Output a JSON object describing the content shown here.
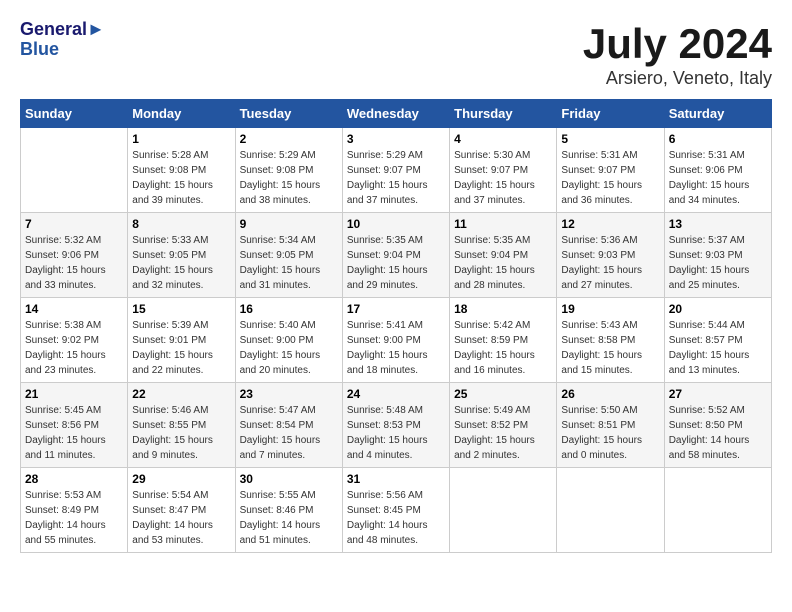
{
  "logo": {
    "line1": "General",
    "line2": "Blue"
  },
  "title": "July 2024",
  "subtitle": "Arsiero, Veneto, Italy",
  "days_of_week": [
    "Sunday",
    "Monday",
    "Tuesday",
    "Wednesday",
    "Thursday",
    "Friday",
    "Saturday"
  ],
  "weeks": [
    [
      {
        "day": "",
        "sunrise": "",
        "sunset": "",
        "daylight": ""
      },
      {
        "day": "1",
        "sunrise": "Sunrise: 5:28 AM",
        "sunset": "Sunset: 9:08 PM",
        "daylight": "Daylight: 15 hours and 39 minutes."
      },
      {
        "day": "2",
        "sunrise": "Sunrise: 5:29 AM",
        "sunset": "Sunset: 9:08 PM",
        "daylight": "Daylight: 15 hours and 38 minutes."
      },
      {
        "day": "3",
        "sunrise": "Sunrise: 5:29 AM",
        "sunset": "Sunset: 9:07 PM",
        "daylight": "Daylight: 15 hours and 37 minutes."
      },
      {
        "day": "4",
        "sunrise": "Sunrise: 5:30 AM",
        "sunset": "Sunset: 9:07 PM",
        "daylight": "Daylight: 15 hours and 37 minutes."
      },
      {
        "day": "5",
        "sunrise": "Sunrise: 5:31 AM",
        "sunset": "Sunset: 9:07 PM",
        "daylight": "Daylight: 15 hours and 36 minutes."
      },
      {
        "day": "6",
        "sunrise": "Sunrise: 5:31 AM",
        "sunset": "Sunset: 9:06 PM",
        "daylight": "Daylight: 15 hours and 34 minutes."
      }
    ],
    [
      {
        "day": "7",
        "sunrise": "Sunrise: 5:32 AM",
        "sunset": "Sunset: 9:06 PM",
        "daylight": "Daylight: 15 hours and 33 minutes."
      },
      {
        "day": "8",
        "sunrise": "Sunrise: 5:33 AM",
        "sunset": "Sunset: 9:05 PM",
        "daylight": "Daylight: 15 hours and 32 minutes."
      },
      {
        "day": "9",
        "sunrise": "Sunrise: 5:34 AM",
        "sunset": "Sunset: 9:05 PM",
        "daylight": "Daylight: 15 hours and 31 minutes."
      },
      {
        "day": "10",
        "sunrise": "Sunrise: 5:35 AM",
        "sunset": "Sunset: 9:04 PM",
        "daylight": "Daylight: 15 hours and 29 minutes."
      },
      {
        "day": "11",
        "sunrise": "Sunrise: 5:35 AM",
        "sunset": "Sunset: 9:04 PM",
        "daylight": "Daylight: 15 hours and 28 minutes."
      },
      {
        "day": "12",
        "sunrise": "Sunrise: 5:36 AM",
        "sunset": "Sunset: 9:03 PM",
        "daylight": "Daylight: 15 hours and 27 minutes."
      },
      {
        "day": "13",
        "sunrise": "Sunrise: 5:37 AM",
        "sunset": "Sunset: 9:03 PM",
        "daylight": "Daylight: 15 hours and 25 minutes."
      }
    ],
    [
      {
        "day": "14",
        "sunrise": "Sunrise: 5:38 AM",
        "sunset": "Sunset: 9:02 PM",
        "daylight": "Daylight: 15 hours and 23 minutes."
      },
      {
        "day": "15",
        "sunrise": "Sunrise: 5:39 AM",
        "sunset": "Sunset: 9:01 PM",
        "daylight": "Daylight: 15 hours and 22 minutes."
      },
      {
        "day": "16",
        "sunrise": "Sunrise: 5:40 AM",
        "sunset": "Sunset: 9:00 PM",
        "daylight": "Daylight: 15 hours and 20 minutes."
      },
      {
        "day": "17",
        "sunrise": "Sunrise: 5:41 AM",
        "sunset": "Sunset: 9:00 PM",
        "daylight": "Daylight: 15 hours and 18 minutes."
      },
      {
        "day": "18",
        "sunrise": "Sunrise: 5:42 AM",
        "sunset": "Sunset: 8:59 PM",
        "daylight": "Daylight: 15 hours and 16 minutes."
      },
      {
        "day": "19",
        "sunrise": "Sunrise: 5:43 AM",
        "sunset": "Sunset: 8:58 PM",
        "daylight": "Daylight: 15 hours and 15 minutes."
      },
      {
        "day": "20",
        "sunrise": "Sunrise: 5:44 AM",
        "sunset": "Sunset: 8:57 PM",
        "daylight": "Daylight: 15 hours and 13 minutes."
      }
    ],
    [
      {
        "day": "21",
        "sunrise": "Sunrise: 5:45 AM",
        "sunset": "Sunset: 8:56 PM",
        "daylight": "Daylight: 15 hours and 11 minutes."
      },
      {
        "day": "22",
        "sunrise": "Sunrise: 5:46 AM",
        "sunset": "Sunset: 8:55 PM",
        "daylight": "Daylight: 15 hours and 9 minutes."
      },
      {
        "day": "23",
        "sunrise": "Sunrise: 5:47 AM",
        "sunset": "Sunset: 8:54 PM",
        "daylight": "Daylight: 15 hours and 7 minutes."
      },
      {
        "day": "24",
        "sunrise": "Sunrise: 5:48 AM",
        "sunset": "Sunset: 8:53 PM",
        "daylight": "Daylight: 15 hours and 4 minutes."
      },
      {
        "day": "25",
        "sunrise": "Sunrise: 5:49 AM",
        "sunset": "Sunset: 8:52 PM",
        "daylight": "Daylight: 15 hours and 2 minutes."
      },
      {
        "day": "26",
        "sunrise": "Sunrise: 5:50 AM",
        "sunset": "Sunset: 8:51 PM",
        "daylight": "Daylight: 15 hours and 0 minutes."
      },
      {
        "day": "27",
        "sunrise": "Sunrise: 5:52 AM",
        "sunset": "Sunset: 8:50 PM",
        "daylight": "Daylight: 14 hours and 58 minutes."
      }
    ],
    [
      {
        "day": "28",
        "sunrise": "Sunrise: 5:53 AM",
        "sunset": "Sunset: 8:49 PM",
        "daylight": "Daylight: 14 hours and 55 minutes."
      },
      {
        "day": "29",
        "sunrise": "Sunrise: 5:54 AM",
        "sunset": "Sunset: 8:47 PM",
        "daylight": "Daylight: 14 hours and 53 minutes."
      },
      {
        "day": "30",
        "sunrise": "Sunrise: 5:55 AM",
        "sunset": "Sunset: 8:46 PM",
        "daylight": "Daylight: 14 hours and 51 minutes."
      },
      {
        "day": "31",
        "sunrise": "Sunrise: 5:56 AM",
        "sunset": "Sunset: 8:45 PM",
        "daylight": "Daylight: 14 hours and 48 minutes."
      },
      {
        "day": "",
        "sunrise": "",
        "sunset": "",
        "daylight": ""
      },
      {
        "day": "",
        "sunrise": "",
        "sunset": "",
        "daylight": ""
      },
      {
        "day": "",
        "sunrise": "",
        "sunset": "",
        "daylight": ""
      }
    ]
  ]
}
